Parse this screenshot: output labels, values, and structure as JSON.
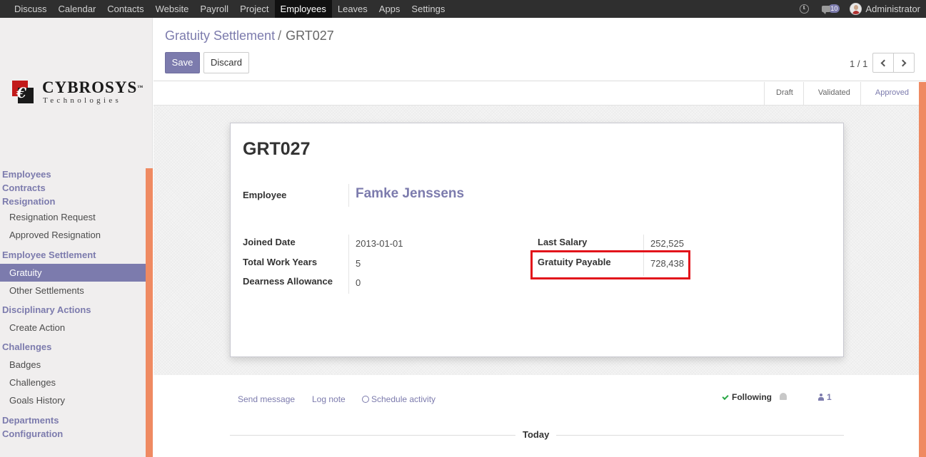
{
  "topbar": {
    "menu": [
      "Discuss",
      "Calendar",
      "Contacts",
      "Website",
      "Payroll",
      "Project",
      "Employees",
      "Leaves",
      "Apps",
      "Settings"
    ],
    "active": "Employees",
    "messages_count": "10",
    "user": "Administrator"
  },
  "logo": {
    "line1": "CYBROSYS",
    "tm": "™",
    "line2": "Technologies"
  },
  "sidebar": {
    "employees": "Employees",
    "contracts": "Contracts",
    "resignation": "Resignation",
    "resignation_request": "Resignation Request",
    "approved_resignation": "Approved Resignation",
    "employee_settlement": "Employee Settlement",
    "gratuity": "Gratuity",
    "other_settlements": "Other Settlements",
    "disciplinary_actions": "Disciplinary Actions",
    "create_action": "Create Action",
    "challenges_section": "Challenges",
    "badges": "Badges",
    "challenges": "Challenges",
    "goals_history": "Goals History",
    "departments": "Departments",
    "configuration": "Configuration"
  },
  "control": {
    "breadcrumb_parent": "Gratuity Settlement",
    "breadcrumb_sep": "/",
    "breadcrumb_current": "GRT027",
    "save_label": "Save",
    "discard_label": "Discard",
    "pager": "1 / 1"
  },
  "status": {
    "steps": [
      "Draft",
      "Validated",
      "Approved"
    ],
    "current": "Approved"
  },
  "form": {
    "title": "GRT027",
    "employee_label": "Employee",
    "employee_value": "Famke Jenssens",
    "joined_date_label": "Joined Date",
    "joined_date_value": "2013-01-01",
    "total_work_years_label": "Total Work Years",
    "total_work_years_value": "5",
    "dearness_allowance_label": "Dearness Allowance",
    "dearness_allowance_value": "0",
    "last_salary_label": "Last Salary",
    "last_salary_value": "252,525",
    "gratuity_payable_label": "Gratuity Payable",
    "gratuity_payable_value": "728,438"
  },
  "chatter": {
    "send_message": "Send message",
    "log_note": "Log note",
    "schedule_activity": "Schedule activity",
    "following": "Following",
    "followers_count": "1",
    "today": "Today"
  },
  "colors": {
    "brand": "#7c7bad",
    "accent_scroll": "#ef8a62",
    "highlight": "#e2141b",
    "topbar": "#2f2f2f"
  }
}
